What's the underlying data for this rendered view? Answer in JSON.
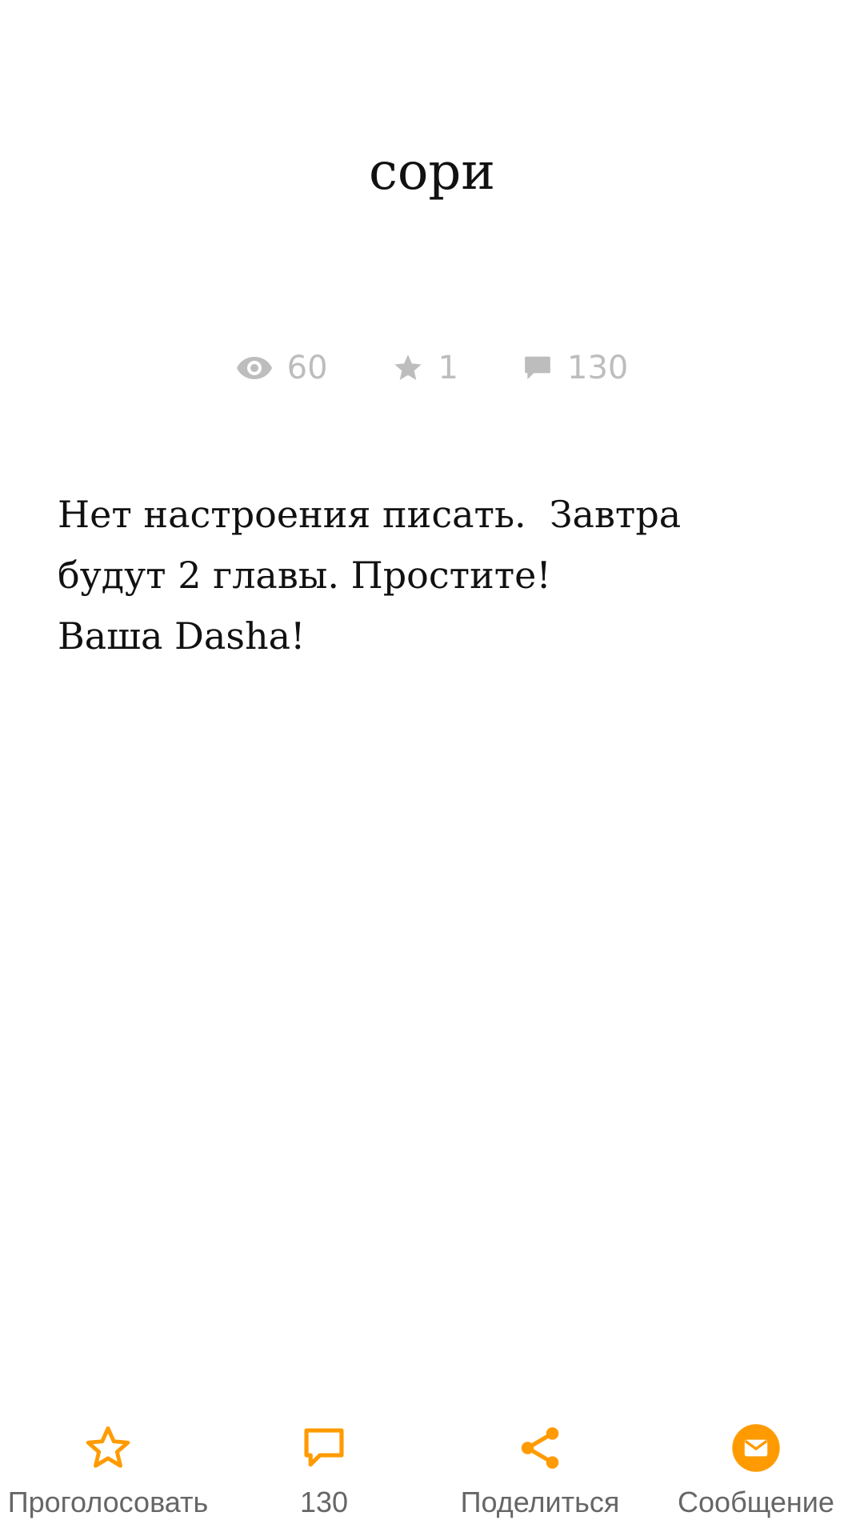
{
  "story": {
    "title": "сори",
    "stats": {
      "views": "60",
      "votes": "1",
      "comments": "130"
    },
    "body_lines": [
      "Нет настроения писать.  Завтра",
      "будут 2 главы. Простите!",
      "Ваша Dasha!"
    ]
  },
  "bottom_bar": {
    "vote_label": "Проголосовать",
    "comments_count": "130",
    "share_label": "Поделиться",
    "message_label": "Сообщение"
  },
  "icons": {
    "views": "eye-icon",
    "votes": "star-icon",
    "comments": "comment-icon",
    "vote_button": "star-outline-icon",
    "comments_button": "comment-outline-icon",
    "share_button": "share-icon",
    "message_button": "mail-icon"
  },
  "colors": {
    "accent": "#ff9b00",
    "stat_gray": "#bdbdbd",
    "label_gray": "#666666",
    "text": "#111111"
  }
}
